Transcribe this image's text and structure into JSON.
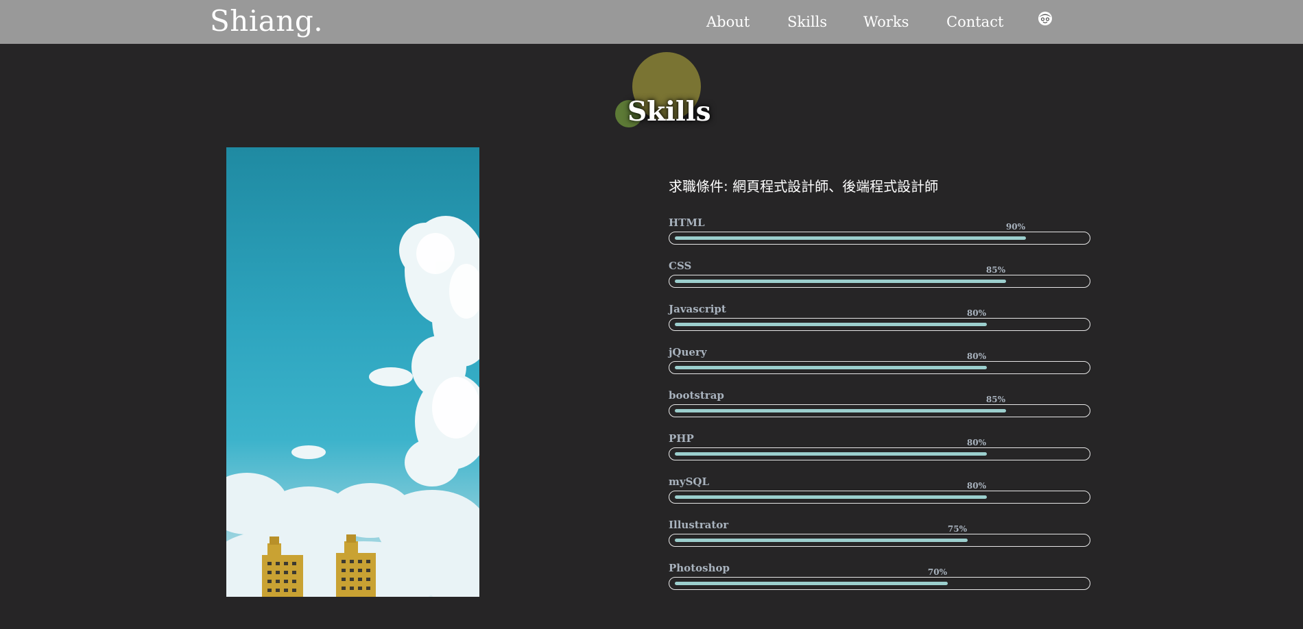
{
  "nav": {
    "brand": "Shiang.",
    "items": [
      "About",
      "Skills",
      "Works",
      "Contact"
    ],
    "avatar_icon": "face-avatar-icon"
  },
  "section": {
    "title": "Skills"
  },
  "photo": {
    "icon": "sky-buildings-photo"
  },
  "skills": {
    "job_line": "求職條件: 網頁程式設計師、後端程式設計師",
    "items": [
      {
        "name": "HTML",
        "percent_label": "90%",
        "level": 0.9
      },
      {
        "name": "CSS",
        "percent_label": "85%",
        "level": 0.85
      },
      {
        "name": "Javascript",
        "percent_label": "80%",
        "level": 0.8
      },
      {
        "name": "jQuery",
        "percent_label": "80%",
        "level": 0.8
      },
      {
        "name": "bootstrap",
        "percent_label": "85%",
        "level": 0.85
      },
      {
        "name": "PHP",
        "percent_label": "80%",
        "level": 0.8
      },
      {
        "name": "mySQL",
        "percent_label": "80%",
        "level": 0.8
      },
      {
        "name": "Illustrator",
        "percent_label": "75%",
        "level": 0.75
      },
      {
        "name": "Photoshop",
        "percent_label": "70%",
        "level": 0.7
      }
    ]
  },
  "colors": {
    "background": "#262526",
    "navbar": "#999999",
    "bar_fill": "#9ccfce",
    "deco_big": "#7a7433",
    "deco_small": "#5d7a36"
  }
}
